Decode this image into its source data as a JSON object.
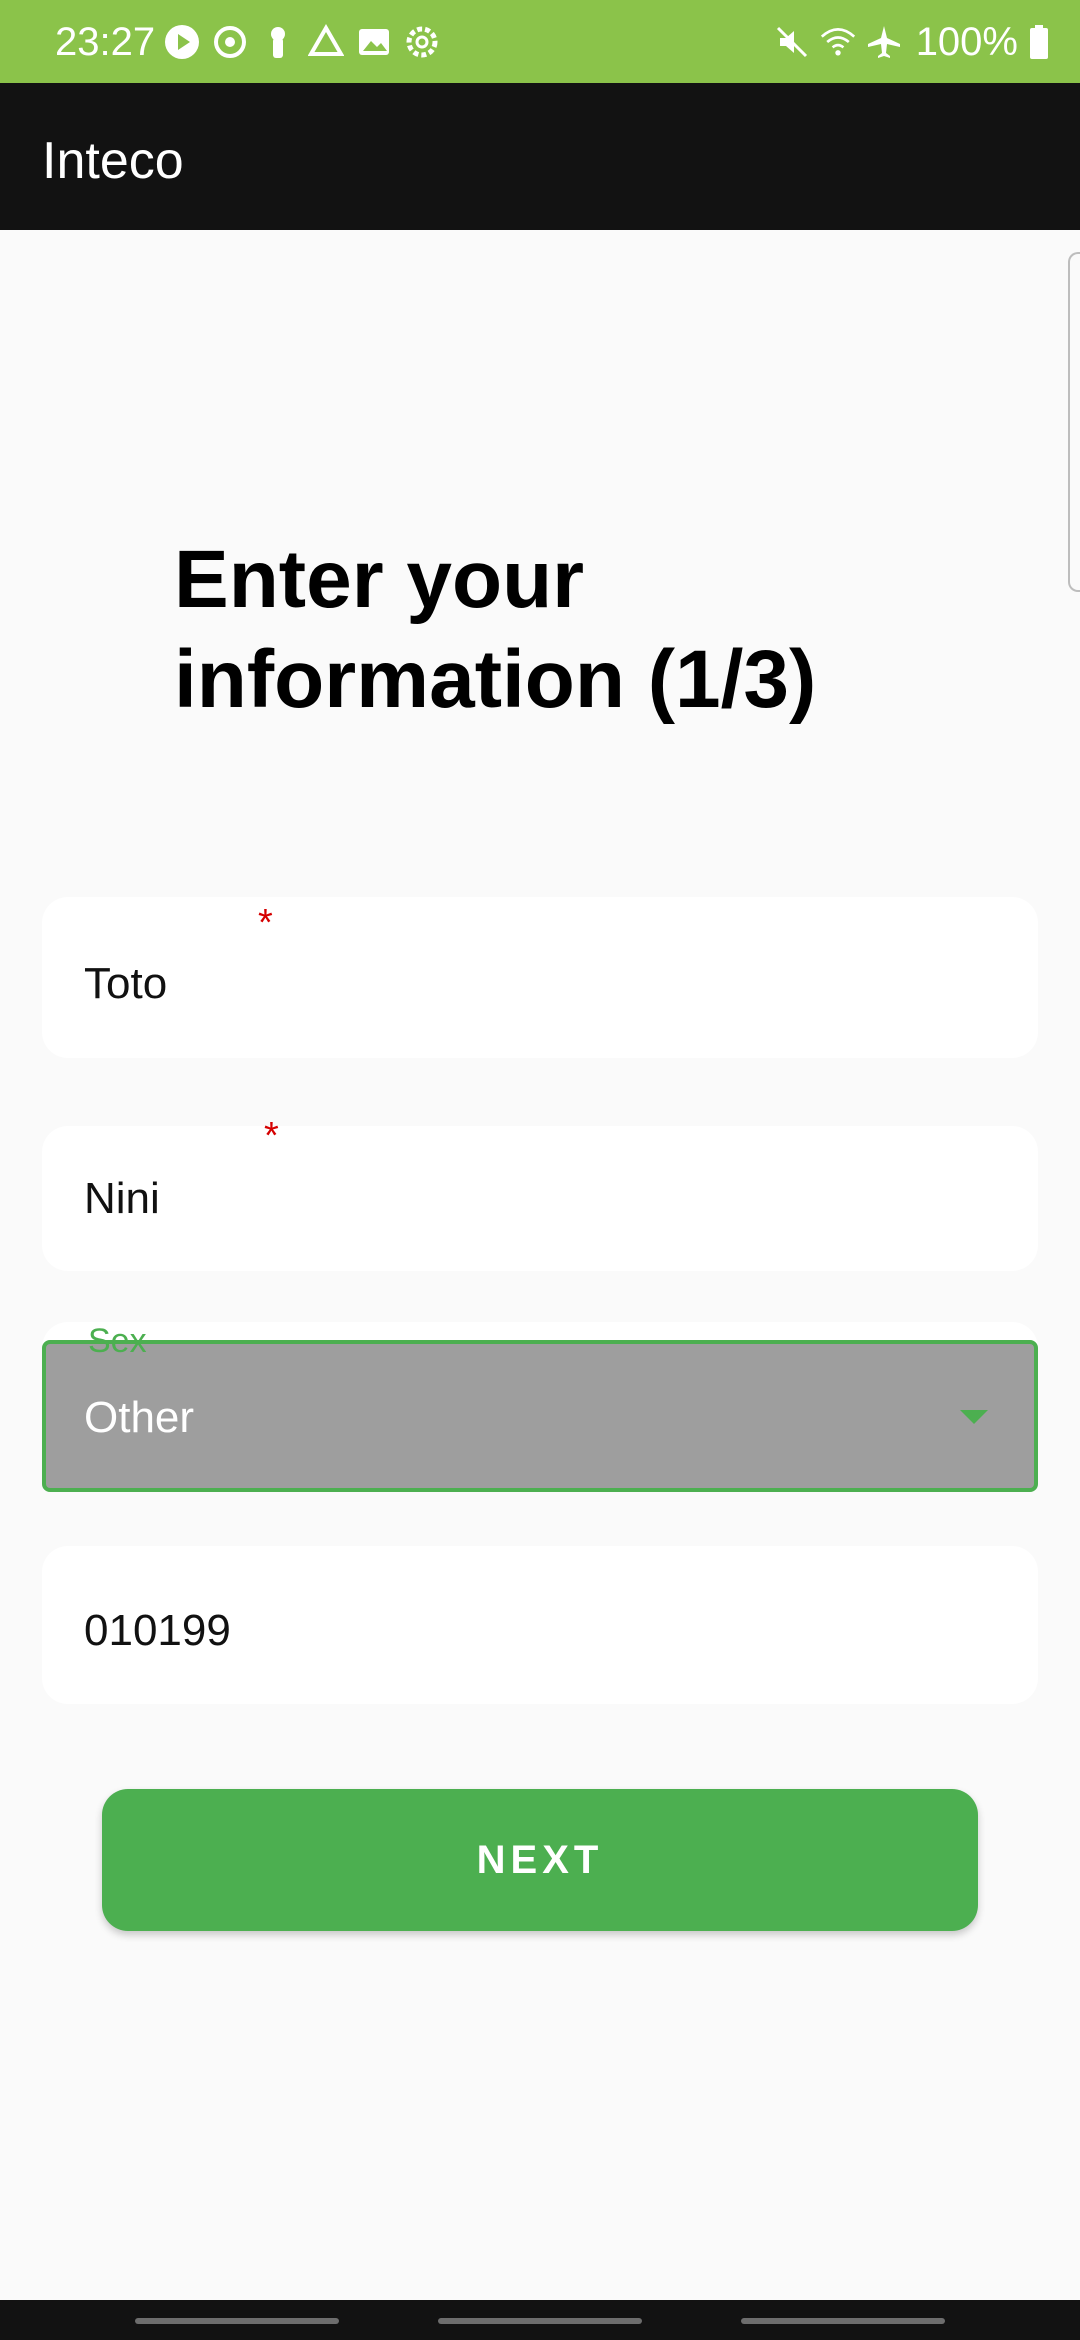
{
  "status_bar": {
    "time": "23:27",
    "battery": "100%",
    "left_icons": [
      "play-icon",
      "sync-icon",
      "keyhole-icon",
      "drive-icon",
      "image-icon",
      "settings-icon"
    ],
    "right_icons": [
      "mute-icon",
      "wifi-icon",
      "airplane-icon",
      "battery-icon"
    ],
    "background": "#8bc34a"
  },
  "app_bar": {
    "title": "Inteco",
    "background": "#121212"
  },
  "page": {
    "heading": "Enter your information (1/3)"
  },
  "form": {
    "first_name": {
      "value": "Toto",
      "required_mark": "*"
    },
    "last_name": {
      "value": "Nini",
      "required_mark": "*"
    },
    "sex": {
      "label": "Sex",
      "selected": "Other"
    },
    "birth_date": {
      "value": "010199"
    }
  },
  "actions": {
    "next_label": "NEXT",
    "accent": "#4caf50"
  }
}
